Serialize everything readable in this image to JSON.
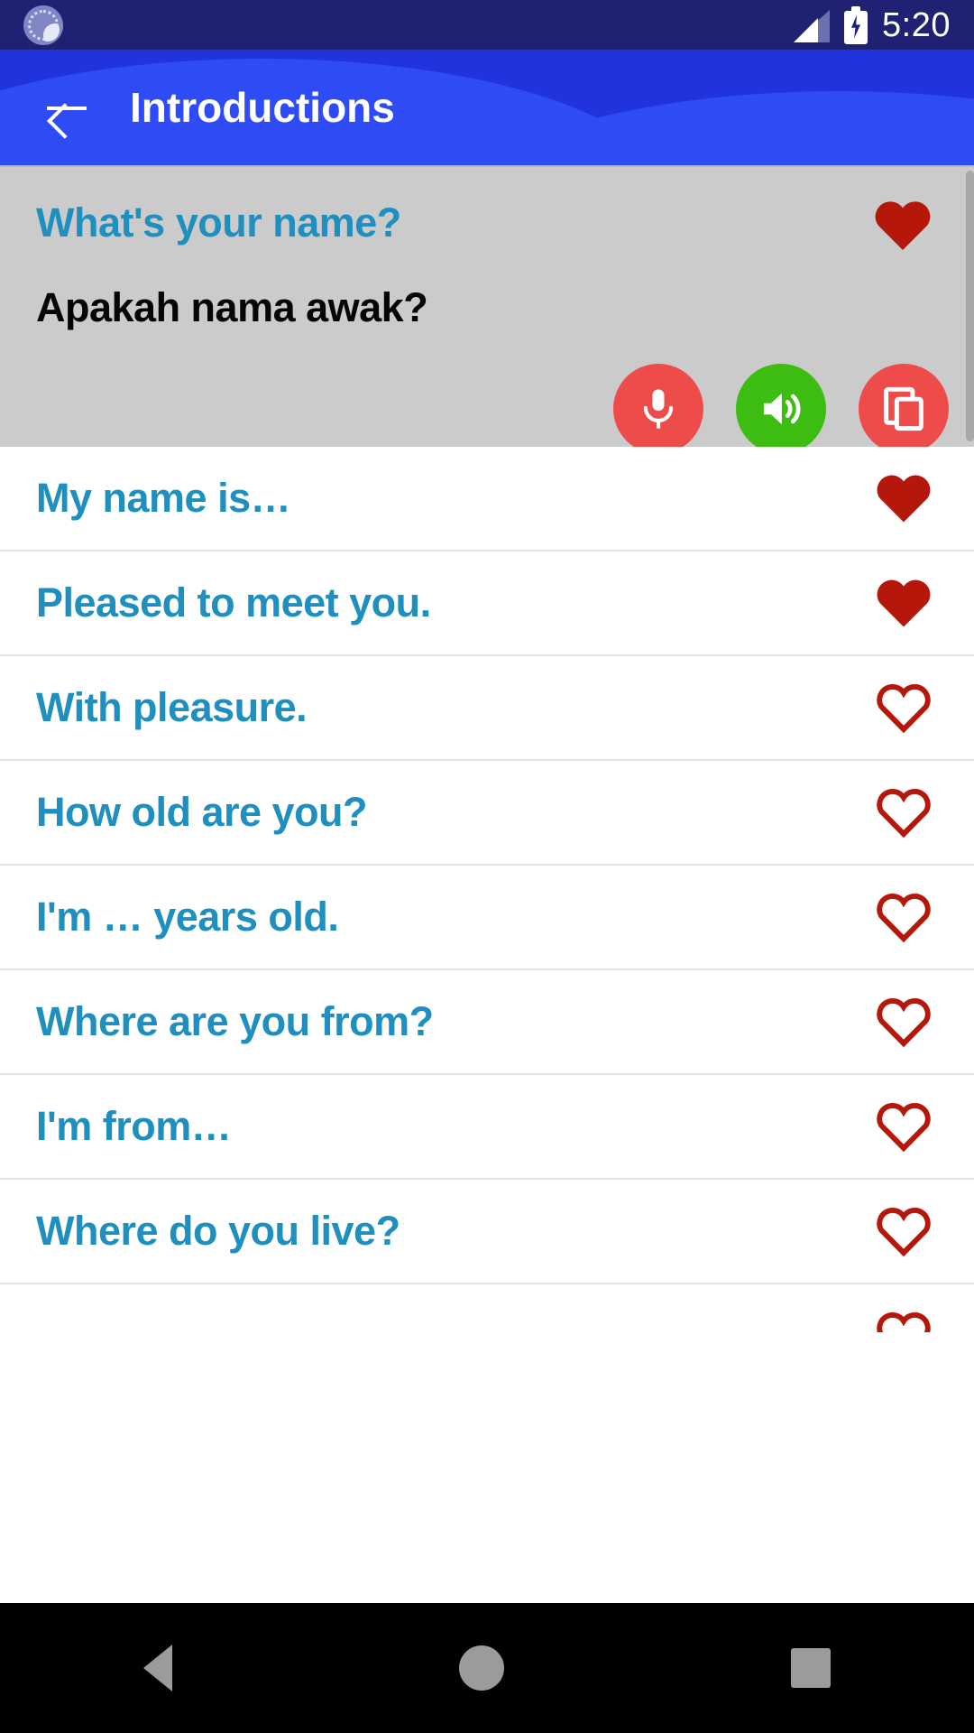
{
  "status_bar": {
    "left_icon": "do-not-disturb-icon",
    "signal_icon": "signal-bars-icon",
    "battery_icon": "battery-charging-icon",
    "time": "5:20",
    "background_color": "#1F2273"
  },
  "app_bar": {
    "back_icon": "back-arrow-icon",
    "title": "Introductions",
    "background_color": "#2033DC",
    "wave_color": "#2E4BF5"
  },
  "featured_card": {
    "source_text": "What's your name?",
    "translation_text": "Apakah nama awak?",
    "favorite_state": "filled",
    "favorite_icon": "heart-filled-icon",
    "background_color": "#CBCBCB",
    "source_color": "#1E8FBE",
    "translation_color": "#050505",
    "actions": [
      {
        "name": "microphone",
        "icon": "microphone-icon",
        "color": "#EE4B4B"
      },
      {
        "name": "speak",
        "icon": "volume-up-icon",
        "color": "#3DBD11"
      },
      {
        "name": "copy",
        "icon": "copy-icon",
        "color": "#EE4B4B"
      }
    ]
  },
  "phrase_list": {
    "text_color": "#1E8FBE",
    "heart_color": "#B5180A",
    "items": [
      {
        "text": "My name is…",
        "favorite": "filled",
        "icon": "heart-filled-icon"
      },
      {
        "text": "Pleased to meet you.",
        "favorite": "filled",
        "icon": "heart-filled-icon"
      },
      {
        "text": "With pleasure.",
        "favorite": "outline",
        "icon": "heart-outline-icon"
      },
      {
        "text": "How old are you?",
        "favorite": "outline",
        "icon": "heart-outline-icon"
      },
      {
        "text": "I'm … years old.",
        "favorite": "outline",
        "icon": "heart-outline-icon"
      },
      {
        "text": "Where are you from?",
        "favorite": "outline",
        "icon": "heart-outline-icon"
      },
      {
        "text": "I'm from…",
        "favorite": "outline",
        "icon": "heart-outline-icon"
      },
      {
        "text": "Where do you live?",
        "favorite": "outline",
        "icon": "heart-outline-icon"
      },
      {
        "text": "",
        "favorite": "outline",
        "icon": "heart-outline-icon"
      }
    ]
  },
  "nav_bar": {
    "back_icon": "nav-back-triangle-icon",
    "home_icon": "nav-home-circle-icon",
    "recents_icon": "nav-recents-square-icon",
    "background_color": "#000000"
  }
}
